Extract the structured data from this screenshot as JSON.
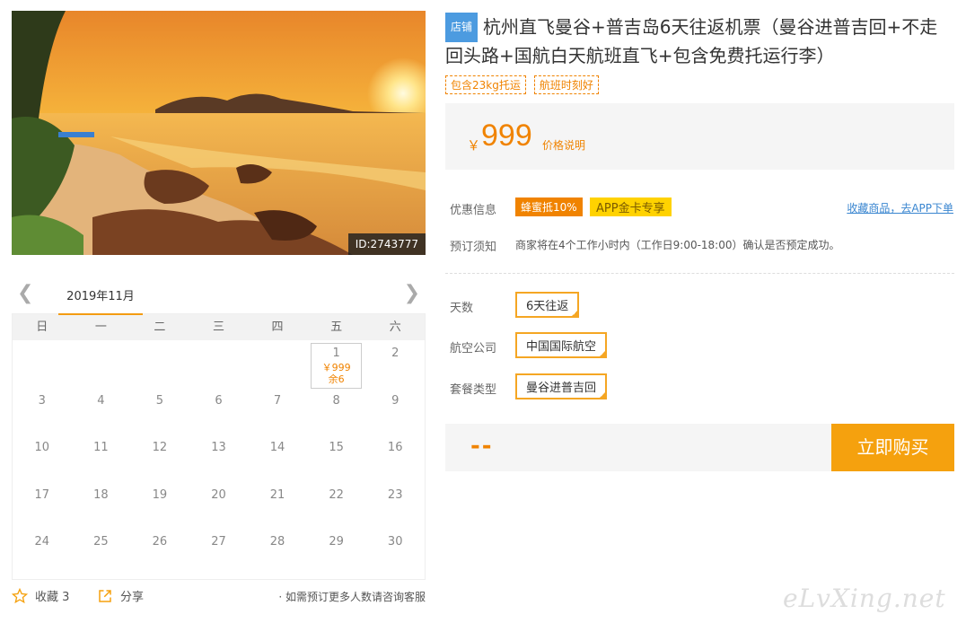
{
  "hero": {
    "image_id": "ID:2743777"
  },
  "calendar": {
    "month": "2019年11月",
    "weekdays": [
      "日",
      "一",
      "二",
      "三",
      "四",
      "五",
      "六"
    ],
    "days": [
      "",
      "",
      "",
      "",
      "",
      "1",
      "2",
      "3",
      "4",
      "5",
      "6",
      "7",
      "8",
      "9",
      "10",
      "11",
      "12",
      "13",
      "14",
      "15",
      "16",
      "17",
      "18",
      "19",
      "20",
      "21",
      "22",
      "23",
      "24",
      "25",
      "26",
      "27",
      "28",
      "29",
      "30"
    ],
    "active_day": {
      "day": "1",
      "price": "￥999",
      "stock": "余6"
    }
  },
  "bottom": {
    "fav_label": "收藏 3",
    "share_label": "分享",
    "consult": "· 如需预订更多人数请咨询客服"
  },
  "product": {
    "shop_badge": "店铺",
    "title": "杭州直飞曼谷+普吉岛6天往返机票（曼谷进普吉回+不走回头路+国航白天航班直飞+包含免费托运行李）",
    "tags": [
      "包含23kg托运",
      "航班时刻好"
    ],
    "currency": "￥",
    "price": "999",
    "price_note": "价格说明"
  },
  "discount": {
    "label": "优惠信息",
    "badge1": "蜂蜜抵10%",
    "badge2": "APP金卡专享",
    "app_link": "收藏商品，去APP下单"
  },
  "notice": {
    "label": "预订须知",
    "text": "商家将在4个工作小时内（工作日9:00-18:00）确认是否预定成功。"
  },
  "options": [
    {
      "label": "天数",
      "value": "6天往返"
    },
    {
      "label": "航空公司",
      "value": "中国国际航空"
    },
    {
      "label": "套餐类型",
      "value": "曼谷进普吉回"
    }
  ],
  "buy": {
    "total": "--",
    "button": "立即购买"
  },
  "watermark": "eLvXing.net",
  "colors": {
    "accent": "#f08300",
    "button": "#f5a10e",
    "link": "#3a86d0",
    "badge_blue": "#4c9be0"
  }
}
